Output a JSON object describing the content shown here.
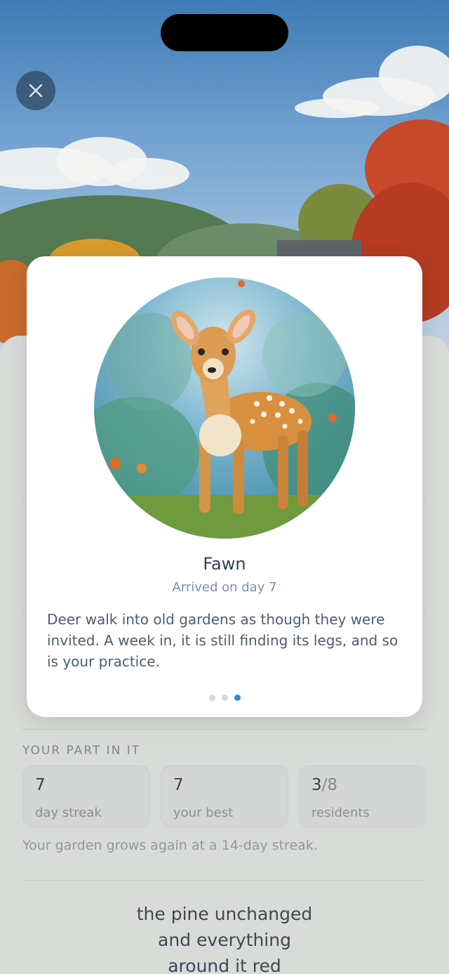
{
  "close": {
    "icon": "close-icon"
  },
  "card": {
    "name": "Fawn",
    "arrived": "Arrived on day 7",
    "description": "Deer walk into old gardens as though they were invited. A week in, it is still finding its legs, and so is your practice.",
    "pager": {
      "count": 3,
      "active_index": 2
    }
  },
  "sheet": {
    "section_label": "YOUR PART IN IT",
    "stats": [
      {
        "value": "7",
        "denominator": "",
        "label": "day streak"
      },
      {
        "value": "7",
        "denominator": "",
        "label": "your best"
      },
      {
        "value": "3",
        "denominator": "/8",
        "label": "residents"
      }
    ],
    "grow_note": "Your garden grows again at a 14-day streak.",
    "haiku": [
      "the pine unchanged",
      "and everything",
      "around it red"
    ]
  },
  "colors": {
    "accent": "#3b82d6",
    "card_bg": "#ffffff",
    "title": "#2e3f52"
  }
}
